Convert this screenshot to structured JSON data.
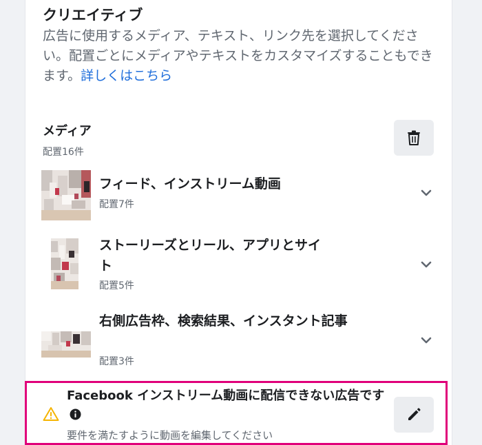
{
  "creative": {
    "title": "クリエイティブ",
    "description": "広告に使用するメディア、テキスト、リンク先を選択してください。配置ごとにメディアやテキストをカスタマイズすることもできます。",
    "learn_more": "詳しくはこちら"
  },
  "media": {
    "title": "メディア",
    "subtitle": "配置16件",
    "delete_icon": "trash-icon",
    "placements": [
      {
        "label": "フィード、インストリーム動画",
        "count": "配置7件"
      },
      {
        "label": "ストーリーズとリール、アプリとサイト",
        "count": "配置5件"
      },
      {
        "label": "右側広告枠、検索結果、インスタント記事",
        "count": "配置3件"
      }
    ]
  },
  "warning": {
    "text": "Facebook インストリーム動画に配信できない広告です",
    "hint": "要件を満たすように動画を編集してください",
    "icon": "warning-triangle-icon",
    "edit_icon": "pencil-icon"
  },
  "colors": {
    "link": "#216fdb",
    "highlight_border": "#e0007a",
    "warning": "#f5b400"
  }
}
